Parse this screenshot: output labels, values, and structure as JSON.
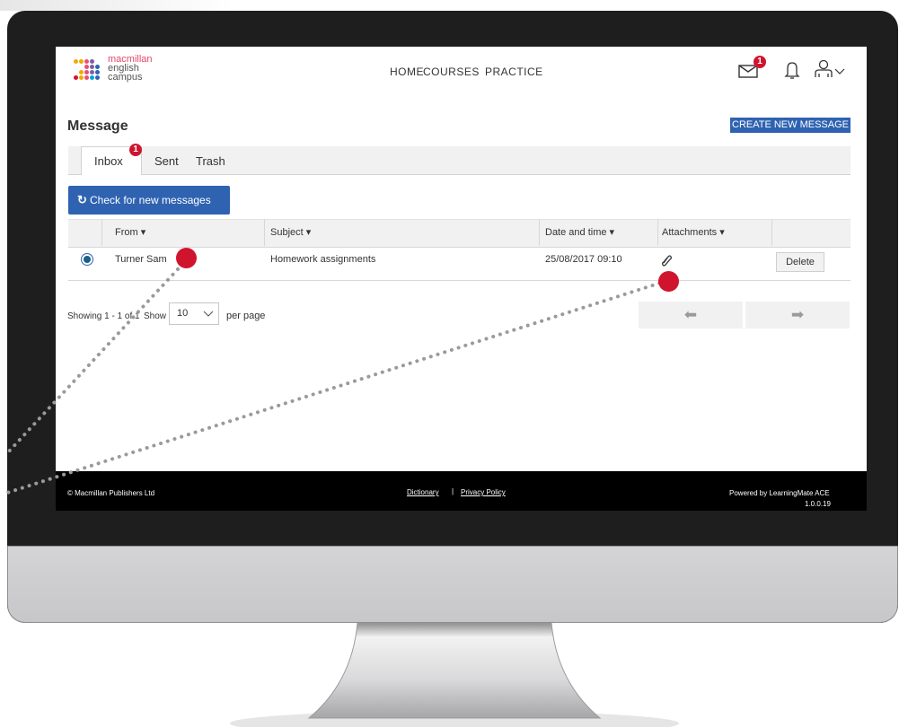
{
  "logo": {
    "line1": "macmillan",
    "line2": "english",
    "line3": "campus"
  },
  "nav": {
    "home": "HOME",
    "courses": "COURSES",
    "practice": "PRACTICE"
  },
  "notifications": {
    "mail_count": "1"
  },
  "page": {
    "title": "Message",
    "create_button": "CREATE NEW MESSAGE"
  },
  "tabs": [
    {
      "label": "Inbox",
      "badge": "1"
    },
    {
      "label": "Sent"
    },
    {
      "label": "Trash"
    }
  ],
  "toolbar": {
    "check_label": "Check for new messages"
  },
  "table": {
    "headers": {
      "from": "From",
      "subject": "Subject",
      "date": "Date and time",
      "attachments": "Attachments"
    },
    "rows": [
      {
        "from": "Turner Sam",
        "subject": "Homework assignments",
        "date": "25/08/2017 09:10",
        "delete": "Delete"
      }
    ]
  },
  "pagination": {
    "showing": "Showing 1 - 1 of 1",
    "show": "Show",
    "per_page_value": "10",
    "per_page": "per page"
  },
  "footer": {
    "copyright": "© Macmillan Publishers Ltd",
    "dictionary": "Dictionary",
    "separator": "|",
    "privacy": "Privacy Policy",
    "powered": "Powered by LearningMate ACE",
    "version": "1.0.0.19"
  },
  "colors": {
    "accent": "#2f63b1",
    "badge": "#d0142e",
    "footer": "#000000",
    "monitor": "#1e1e1e"
  },
  "icons": {
    "mail": "mail-icon",
    "bell": "bell-icon",
    "user": "user-icon",
    "refresh": "refresh-icon",
    "paperclip": "paperclip-icon",
    "arrow_left": "arrow-left-icon",
    "arrow_right": "arrow-right-icon"
  }
}
